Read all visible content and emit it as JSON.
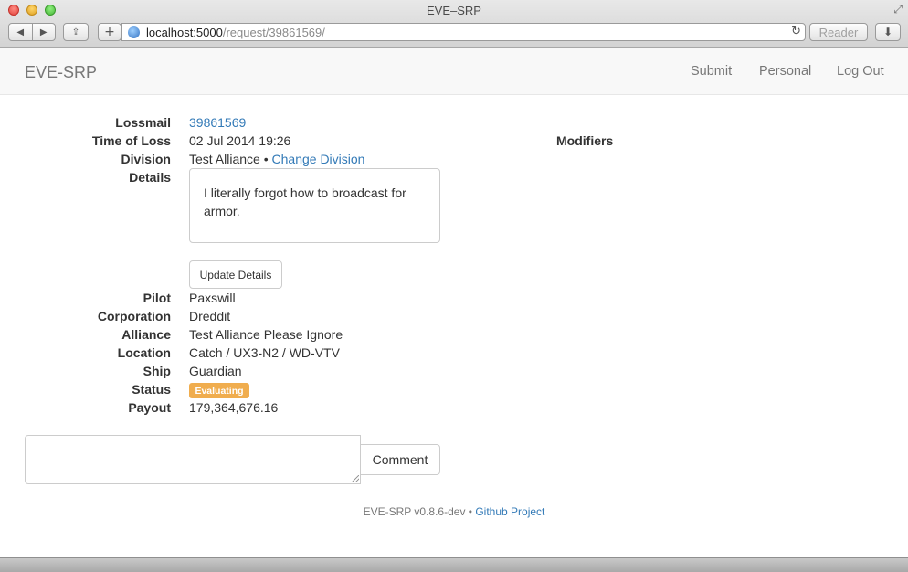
{
  "browser": {
    "window_title": "EVE–SRP",
    "url_host": "localhost:5000",
    "url_path": "/request/39861569/",
    "reader_label": "Reader",
    "icons": {
      "back": "◀",
      "forward": "▶",
      "share": "⇪",
      "add": "+",
      "reload": "↻",
      "download": "⬇",
      "resize": "⤢"
    }
  },
  "navbar": {
    "brand": "EVE-SRP",
    "links": [
      "Submit",
      "Personal",
      "Log Out"
    ]
  },
  "request": {
    "labels": {
      "lossmail": "Lossmail",
      "time_of_loss": "Time of Loss",
      "division": "Division",
      "details": "Details",
      "pilot": "Pilot",
      "corporation": "Corporation",
      "alliance": "Alliance",
      "location": "Location",
      "ship": "Ship",
      "status": "Status",
      "payout": "Payout"
    },
    "lossmail_id": "39861569",
    "time_of_loss": "02 Jul 2014 19:26",
    "division": "Test Alliance",
    "division_separator": "•",
    "change_division": "Change Division",
    "details_text": "I literally forgot how to broadcast for armor.",
    "update_details_label": "Update Details",
    "pilot": "Paxswill",
    "corporation": "Dreddit",
    "alliance": "Test Alliance Please Ignore",
    "location": "Catch / UX3-N2 / WD-VTV",
    "ship": "Guardian",
    "status": "Evaluating",
    "status_color": "#f0ad4e",
    "payout": "179,364,676.16"
  },
  "modifiers": {
    "heading": "Modifiers"
  },
  "comment": {
    "value": "",
    "button_label": "Comment"
  },
  "footer": {
    "version": "EVE-SRP v0.8.6-dev",
    "separator": "•",
    "project_link": "Github Project"
  }
}
